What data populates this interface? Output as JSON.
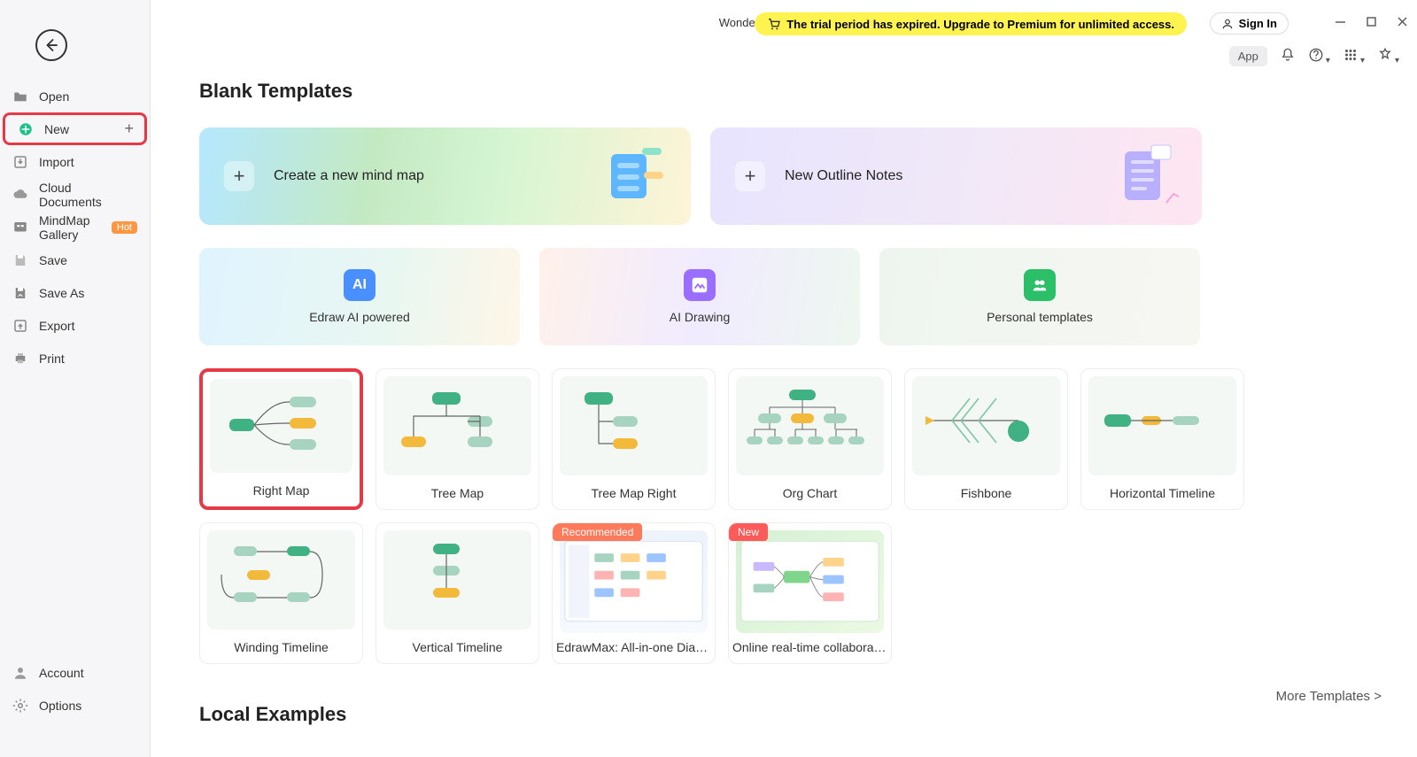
{
  "app_title": "Wondershare EdrawMind",
  "trial_message": "The trial period has expired. Upgrade to Premium for unlimited access.",
  "signin_label": "Sign In",
  "toolbar2": {
    "app_chip": "App"
  },
  "sidebar": {
    "items": [
      {
        "label": "Open"
      },
      {
        "label": "New"
      },
      {
        "label": "Import"
      },
      {
        "label": "Cloud Documents"
      },
      {
        "label": "MindMap Gallery"
      },
      {
        "label": "Save"
      },
      {
        "label": "Save As"
      },
      {
        "label": "Export"
      },
      {
        "label": "Print"
      }
    ],
    "hot_badge": "Hot",
    "account_label": "Account",
    "options_label": "Options"
  },
  "sections": {
    "blank_templates": "Blank Templates",
    "local_examples": "Local Examples"
  },
  "large_cards": {
    "create_mindmap": "Create a new mind map",
    "new_outline": "New Outline Notes"
  },
  "feature_cards": {
    "ai_powered": "Edraw AI powered",
    "ai_drawing": "AI Drawing",
    "personal_templates": "Personal templates"
  },
  "templates": {
    "row1": [
      "Right Map",
      "Tree Map",
      "Tree Map Right",
      "Org Chart",
      "Fishbone",
      "Horizontal Timeline"
    ],
    "row2": [
      "Winding Timeline",
      "Vertical Timeline",
      "EdrawMax: All-in-one Diag...",
      "Online real-time collaborat..."
    ],
    "badge_recommended": "Recommended",
    "badge_new": "New"
  },
  "more_templates": "More Templates  >"
}
